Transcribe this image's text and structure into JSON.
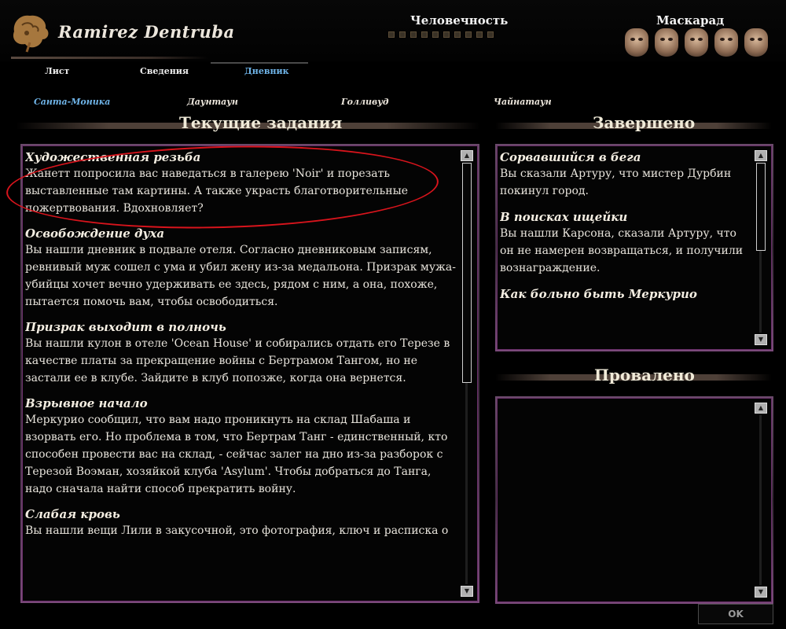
{
  "character": {
    "name": "Ramirez Dentruba"
  },
  "humanity": {
    "title": "Человечность",
    "dots": 10
  },
  "masquerade": {
    "title": "Маскарад",
    "masks": 5
  },
  "tabs": [
    {
      "label": "Лист",
      "active": false
    },
    {
      "label": "Сведения",
      "active": false
    },
    {
      "label": "Дневник",
      "active": true
    }
  ],
  "regions": [
    {
      "label": "Санта-Моника",
      "active": true
    },
    {
      "label": "Даунтаун",
      "active": false
    },
    {
      "label": "Голливуд",
      "active": false
    },
    {
      "label": "Чайнатаун",
      "active": false
    }
  ],
  "current": {
    "title": "Текущие задания",
    "quests": [
      {
        "title": "Художественная резьба",
        "desc": "Жанетт попросила вас наведаться в галерею 'Noir' и порезать выставленные там картины. А также украсть благотворительные пожертвования. Вдохновляет?"
      },
      {
        "title": "Освобождение духа",
        "desc": "Вы нашли дневник в подвале отеля. Согласно дневниковым записям, ревнивый муж сошел с ума и убил жену из-за медальона. Призрак мужа-убийцы хочет вечно удерживать ее здесь, рядом с ним, а она, похоже, пытается помочь вам, чтобы освободиться."
      },
      {
        "title": "Призрак выходит в полночь",
        "desc": "Вы нашли кулон в отеле 'Ocean House' и собирались отдать его Терезе в качестве платы за прекращение войны с Бертрамом Тангом, но не застали ее в клубе. Зайдите в клуб попозже, когда она вернется."
      },
      {
        "title": "Взрывное начало",
        "desc": "Меркурио сообщил, что вам надо проникнуть на склад Шабаша и взорвать его. Но проблема в том, что Бертрам Танг - единственный, кто способен провести вас на склад, - сейчас залег на дно из-за разборок с Терезой Воэман, хозяйкой клуба 'Asylum'. Чтобы добраться до Танга, надо сначала найти способ прекратить войну."
      },
      {
        "title": "Слабая кровь",
        "desc": "Вы нашли вещи Лили в закусочной, это фотография, ключ и расписка о"
      }
    ]
  },
  "completed": {
    "title": "Завершено",
    "quests": [
      {
        "title": "Сорвавшийся в бега",
        "desc": "Вы сказали Артуру, что мистер Дурбин покинул город."
      },
      {
        "title": "В поисках ищейки",
        "desc": "Вы нашли Карсона, сказали Артуру, что он не намерен возвращаться, и получили вознаграждение."
      },
      {
        "title": "Как больно быть Меркурио",
        "desc": ""
      }
    ]
  },
  "failed": {
    "title": "Провалено",
    "quests": []
  },
  "ok_button": {
    "label": "OK"
  },
  "colors": {
    "accent_active": "#6fb4e8",
    "panel_border": "#6a2f6a",
    "annotation": "#d8141c"
  }
}
